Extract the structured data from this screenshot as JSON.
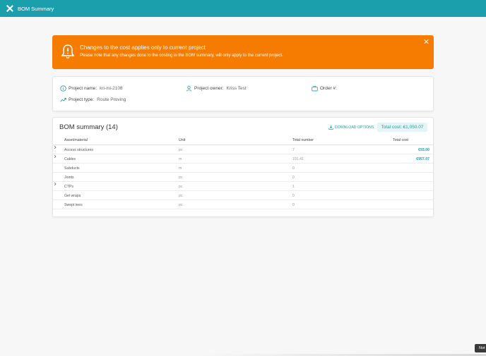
{
  "header": {
    "title": "BOM Summary"
  },
  "alert": {
    "title": "Changes to the cost applies only to current project",
    "text": "Please note that any changes done to the costing in the BOM summary, will only apply to the current project."
  },
  "project": {
    "name_label": "Project name:",
    "name_value": "kri-mi-2108",
    "owner_label": "Project owner:",
    "owner_value": "Kriss Test",
    "order_label": "Order #:",
    "order_value": "",
    "type_label": "Project type:",
    "type_value": "Route Proving"
  },
  "bom": {
    "title": "BOM summary (14)",
    "download_label": "DOWNLOAD OPTIONS",
    "total_cost": "Total cost: €1,050.07",
    "columns": [
      "Asset/material",
      "Unit",
      "Total number",
      "Total cost"
    ],
    "rows": [
      {
        "name": "Access structures",
        "unit": "pc",
        "total": "7",
        "cost": "€93.00"
      },
      {
        "name": "Cables",
        "unit": "m",
        "total": "191.41",
        "cost": "€957.07"
      },
      {
        "name": "Subducts",
        "unit": "m",
        "total": "0",
        "cost": ""
      },
      {
        "name": "Joints",
        "unit": "pc",
        "total": "0",
        "cost": ""
      },
      {
        "name": "CTPs",
        "unit": "pc",
        "total": "1",
        "cost": ""
      },
      {
        "name": "Gel wraps",
        "unit": "pc",
        "total": "0",
        "cost": ""
      },
      {
        "name": "Swept tees",
        "unit": "pc",
        "total": "0",
        "cost": ""
      }
    ]
  },
  "tooltip": {
    "text": "Not"
  },
  "colors": {
    "accent": "#1c9fad",
    "alert": "#f57c00"
  }
}
